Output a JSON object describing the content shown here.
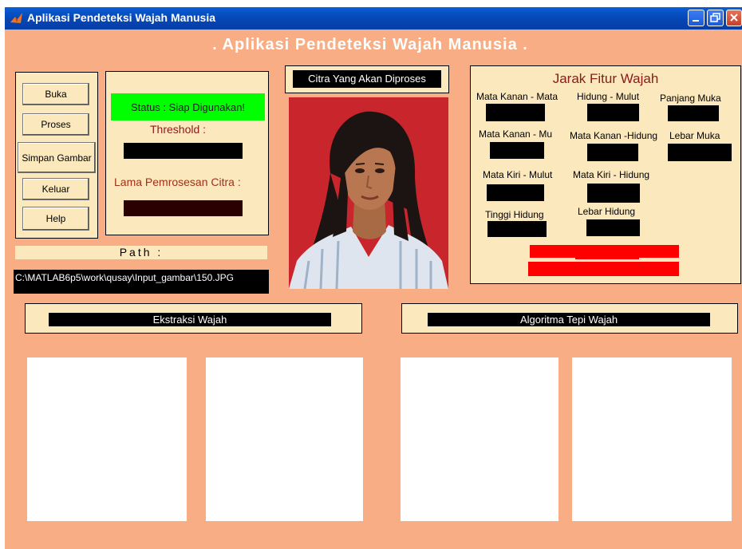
{
  "window": {
    "title": "Aplikasi Pendeteksi Wajah Manusia"
  },
  "app": {
    "heading": ". Aplikasi Pendeteksi Wajah Manusia ."
  },
  "buttons": {
    "buka": "Buka",
    "proses": "Proses",
    "simpan": "Simpan Gambar",
    "keluar": "Keluar",
    "help": "Help"
  },
  "status": {
    "text": "Status : Siap Digunakan!",
    "threshold_label": "Threshold :",
    "threshold_value": "",
    "lama_label": "Lama Pemrosesan Citra :",
    "lama_value": ""
  },
  "path": {
    "label": "Path :",
    "value": "C:\\MATLAB6p5\\work\\qusay\\Input_gambar\\150.JPG"
  },
  "image": {
    "title": "Citra Yang Akan Diproses"
  },
  "features": {
    "title": "Jarak Fitur Wajah",
    "mata_kanan_mata": "Mata Kanan - Mata",
    "hidung_mulut": "Hidung - Mulut",
    "panjang_muka": "Panjang Muka",
    "mata_kanan_mu": "Mata Kanan - Mu",
    "mata_kanan_hidung": "Mata Kanan -Hidung",
    "lebar_muka": "Lebar Muka",
    "mata_kiri_mulut": "Mata Kiri - Mulut",
    "mata_kiri_hidung": "Mata Kiri - Hidung",
    "tinggi_hidung": "Tinggi Hidung",
    "lebar_hidung": "Lebar  Hidung"
  },
  "sections": {
    "ekstraksi": "Ekstraksi Wajah",
    "algoritma": "Algoritma Tepi Wajah"
  },
  "colors": {
    "background": "#f8ad84",
    "panel": "#fbe8bc",
    "status_green": "#00ff00",
    "accent_red": "#ff0000",
    "dark_red": "#2b0000",
    "title_red": "#8b0000"
  }
}
